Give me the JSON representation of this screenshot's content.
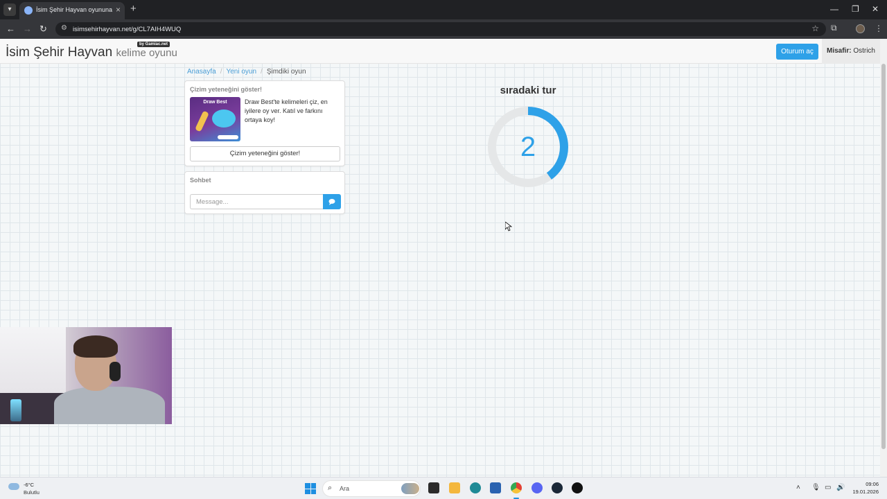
{
  "browser": {
    "tab_title": "İsim Şehir Hayvan oyununa katıl",
    "url": "isimsehirhayvan.net/g/CL7AIH4WUQ"
  },
  "navbar": {
    "brand_title": "İsim Şehir Hayvan",
    "brand_subtitle": "kelime oyunu",
    "brand_badge": "by Gamiac.net",
    "login_label": "Oturum aç",
    "guest_label": "Misafir:",
    "guest_name": "Ostrich"
  },
  "breadcrumb": {
    "home": "Anasayfa",
    "new_game": "Yeni oyun",
    "current": "Şimdiki oyun"
  },
  "promo": {
    "title": "Çizim yeteneğini göster!",
    "image_title": "Draw Best",
    "text": "Draw Best'te kelimeleri çiz, en iyilere oy ver. Katıl ve farkını ortaya koy!",
    "button_label": "Çizim yeteneğini göster!"
  },
  "chat": {
    "title": "Sohbet",
    "placeholder": "Message...",
    "value": ""
  },
  "countdown": {
    "title": "sıradaki tur",
    "value": "2",
    "progress": 0.4,
    "accent_color": "#2ea1e8",
    "track_color": "#e5e7e8"
  },
  "taskbar": {
    "weather_temp": "-6°C",
    "weather_desc": "Bulutlu",
    "search_label": "Ara",
    "time": "09:06",
    "date": "19.01.2026",
    "apps": [
      "file-explorer",
      "terminal",
      "folder",
      "edge",
      "store",
      "chrome",
      "discord",
      "steam",
      "app"
    ]
  }
}
